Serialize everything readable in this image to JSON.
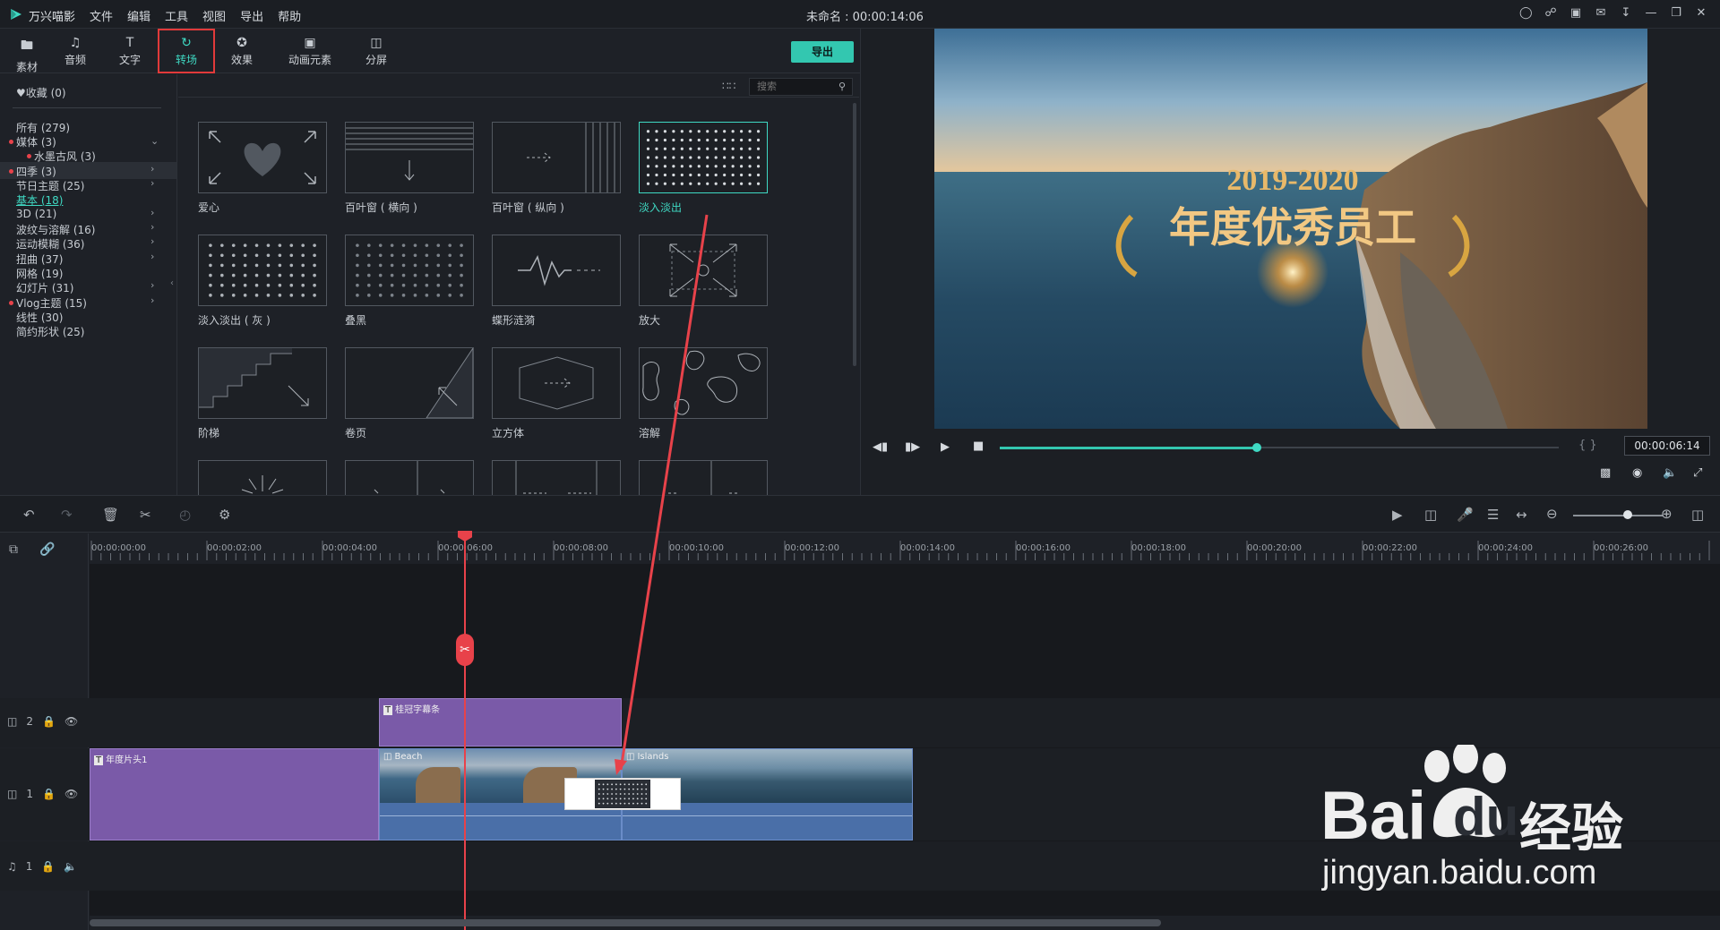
{
  "app": {
    "name": "万兴喵影",
    "window_title": "未命名 : 00:00:14:06"
  },
  "menu": [
    "文件",
    "编辑",
    "工具",
    "视图",
    "导出",
    "帮助"
  ],
  "window_icons": [
    "user-icon",
    "cart-icon",
    "save-icon",
    "mail-icon",
    "download-icon",
    "minimize-icon",
    "restore-icon",
    "close-icon"
  ],
  "tabs": [
    {
      "label": "素材",
      "icon": "folder-icon"
    },
    {
      "label": "音频",
      "icon": "music-icon"
    },
    {
      "label": "文字",
      "icon": "text-icon"
    },
    {
      "label": "转场",
      "icon": "transition-icon",
      "active": true
    },
    {
      "label": "效果",
      "icon": "effects-icon"
    },
    {
      "label": "动画元素",
      "icon": "image-icon"
    },
    {
      "label": "分屏",
      "icon": "splitscreen-icon"
    }
  ],
  "export_label": "导出",
  "search": {
    "placeholder": "搜索"
  },
  "sidebar": {
    "favorites": "收藏 (0)",
    "items": [
      {
        "label": "所有 (279)"
      },
      {
        "label": "媒体 (3)",
        "dot": true,
        "expanded": true
      },
      {
        "label": "水墨古风 (3)",
        "dot": true,
        "sub": true
      },
      {
        "label": "四季 (3)",
        "dot": true,
        "highlight": true
      },
      {
        "label": "节日主题 (25)"
      },
      {
        "label": "基本 (18)",
        "selected": true
      },
      {
        "label": "3D (21)"
      },
      {
        "label": "波纹与溶解 (16)"
      },
      {
        "label": "运动模糊 (36)"
      },
      {
        "label": "扭曲 (37)"
      },
      {
        "label": "网格 (19)"
      },
      {
        "label": "幻灯片 (31)"
      },
      {
        "label": "Vlog主题 (15)",
        "dot": true
      },
      {
        "label": "线性 (30)"
      },
      {
        "label": "简约形状 (25)"
      }
    ]
  },
  "transitions": [
    {
      "label": "爱心"
    },
    {
      "label": "百叶窗 ( 横向 )"
    },
    {
      "label": "百叶窗 ( 纵向 )"
    },
    {
      "label": "淡入淡出",
      "selected": true
    },
    {
      "label": "淡入淡出 ( 灰 )"
    },
    {
      "label": "叠黑"
    },
    {
      "label": "蝶形涟漪"
    },
    {
      "label": "放大"
    },
    {
      "label": "阶梯"
    },
    {
      "label": "卷页"
    },
    {
      "label": "立方体"
    },
    {
      "label": "溶解"
    }
  ],
  "preview": {
    "overlay_year": "2019-2020",
    "overlay_title": "年度优秀员工",
    "timecode": "00:00:06:14",
    "progress": 0.46
  },
  "timeline": {
    "ruler": [
      "00:00:00:00",
      "00:00:02:00",
      "00:00:04:00",
      "00:00:06:00",
      "00:00:08:00",
      "00:00:10:00",
      "00:00:12:00",
      "00:00:14:00",
      "00:00:16:00",
      "00:00:18:00",
      "00:00:20:00",
      "00:00:22:00",
      "00:00:24:00",
      "00:00:26:00"
    ],
    "tracks": [
      {
        "label": "2",
        "type": "video"
      },
      {
        "label": "1",
        "type": "video"
      },
      {
        "label": "1",
        "type": "audio"
      }
    ],
    "clips": {
      "title_clip": "桂冠字幕条",
      "intro_clip": "年度片头1",
      "beach_clip": "Beach",
      "islands_clip": "Islands"
    }
  },
  "watermark": {
    "brand": "Bai",
    "brand2": "du",
    "cn": "经验",
    "url": "jingyan.baidu.com"
  },
  "colors": {
    "accent": "#3fd9c3",
    "highlight_red": "#e13a3a",
    "title_clip": "#7a5aa8",
    "export_btn": "#33c7b0"
  }
}
